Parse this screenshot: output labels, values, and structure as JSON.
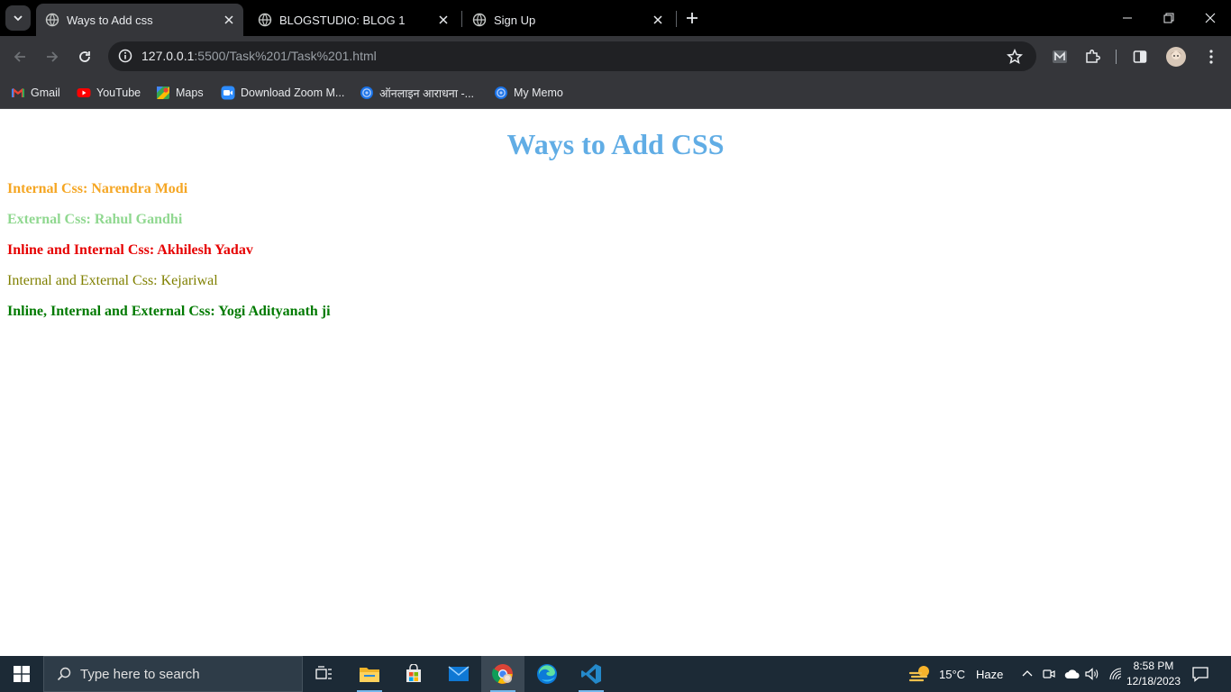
{
  "browser": {
    "tabs": [
      {
        "title": "Ways to Add css",
        "active": true
      },
      {
        "title": "BLOGSTUDIO: BLOG 1",
        "active": false
      },
      {
        "title": "Sign Up",
        "active": false
      }
    ],
    "url_host": "127.0.0.1",
    "url_path": ":5500/Task%201/Task%201.html",
    "bookmarks": [
      {
        "label": "Gmail",
        "icon": "gmail-icon"
      },
      {
        "label": "YouTube",
        "icon": "youtube-icon"
      },
      {
        "label": "Maps",
        "icon": "maps-icon"
      },
      {
        "label": "Download Zoom M...",
        "icon": "zoom-icon"
      },
      {
        "label": "ऑनलाइन आराधना -...",
        "icon": "globe-icon"
      },
      {
        "label": "My Memo",
        "icon": "globe-icon"
      }
    ]
  },
  "page": {
    "heading": "Ways to Add CSS",
    "heading_color": "#61ADE5",
    "lines": [
      {
        "text": "Internal Css: Narendra Modi",
        "color": "#F5A623",
        "bold": true
      },
      {
        "text": "External Css: Rahul Gandhi",
        "color": "#90D890",
        "bold": true
      },
      {
        "text": "Inline and Internal Css: Akhilesh Yadav",
        "color": "#E60000",
        "bold": true
      },
      {
        "text": "Internal and External Css: Kejariwal",
        "color": "#808000",
        "bold": false
      },
      {
        "text": "Inline, Internal and External Css: Yogi Adityanath ji",
        "color": "#007A00",
        "bold": true
      }
    ]
  },
  "taskbar": {
    "search_placeholder": "Type here to search",
    "weather_temp": "15°C",
    "weather_text": "Haze",
    "time": "8:58 PM",
    "date": "12/18/2023"
  }
}
